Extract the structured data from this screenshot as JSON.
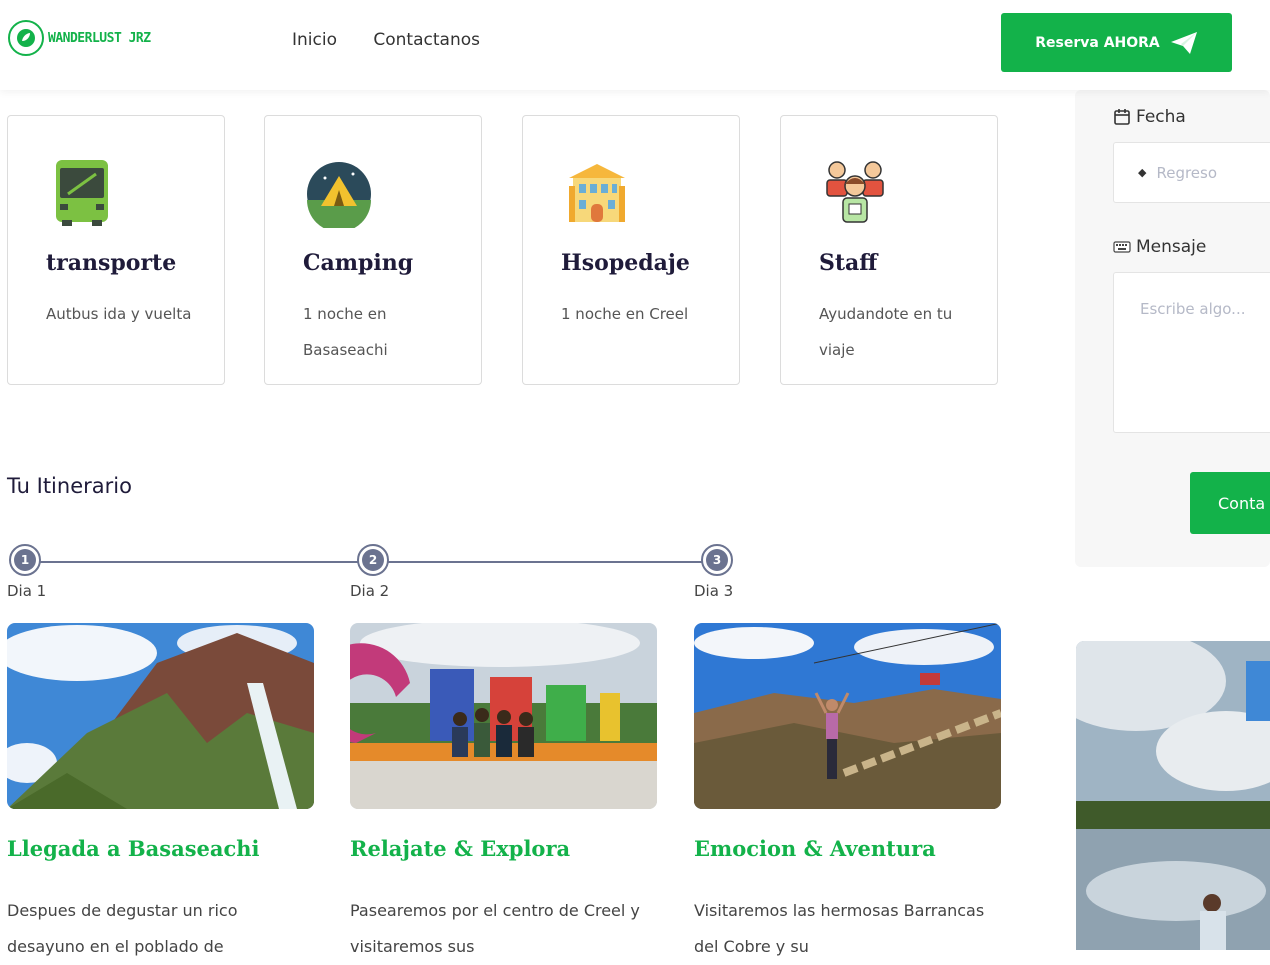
{
  "header": {
    "brand": "WANDERLUST JRZ",
    "nav": [
      "Inicio",
      "Contactanos"
    ],
    "cta": "Reserva AHORA"
  },
  "services": [
    {
      "title": "transporte",
      "desc": "Autbus ida y vuelta",
      "icon": "bus-icon"
    },
    {
      "title": "Camping",
      "desc": "1 noche en Basaseachi",
      "icon": "camping-tent-icon"
    },
    {
      "title": "Hsopedaje",
      "desc": "1 noche en Creel",
      "icon": "hotel-icon"
    },
    {
      "title": "Staff",
      "desc": "Ayudandote en tu viaje",
      "icon": "staff-people-icon"
    }
  ],
  "itinerary": {
    "heading": "Tu Itinerario",
    "days": [
      {
        "step": "1",
        "label": "Dia 1",
        "title": "Llegada a Basaseachi",
        "text": "Despues de degustar un rico desayuno en el poblado de"
      },
      {
        "step": "2",
        "label": "Dia 2",
        "title": "Relajate & Explora",
        "text": "Pasearemos por el centro de Creel y visitaremos sus"
      },
      {
        "step": "3",
        "label": "Dia 3",
        "title": "Emocion & Aventura",
        "text": "Visitaremos las hermosas Barrancas del Cobre y su"
      }
    ]
  },
  "form": {
    "date_label": "Fecha",
    "date_placeholder": "Regreso",
    "message_label": "Mensaje",
    "message_placeholder": "Escribe algo...",
    "submit_label": "Conta"
  },
  "colors": {
    "accent": "#13b24a",
    "heading": "#1f1b3a",
    "timeline": "#6b7390"
  }
}
